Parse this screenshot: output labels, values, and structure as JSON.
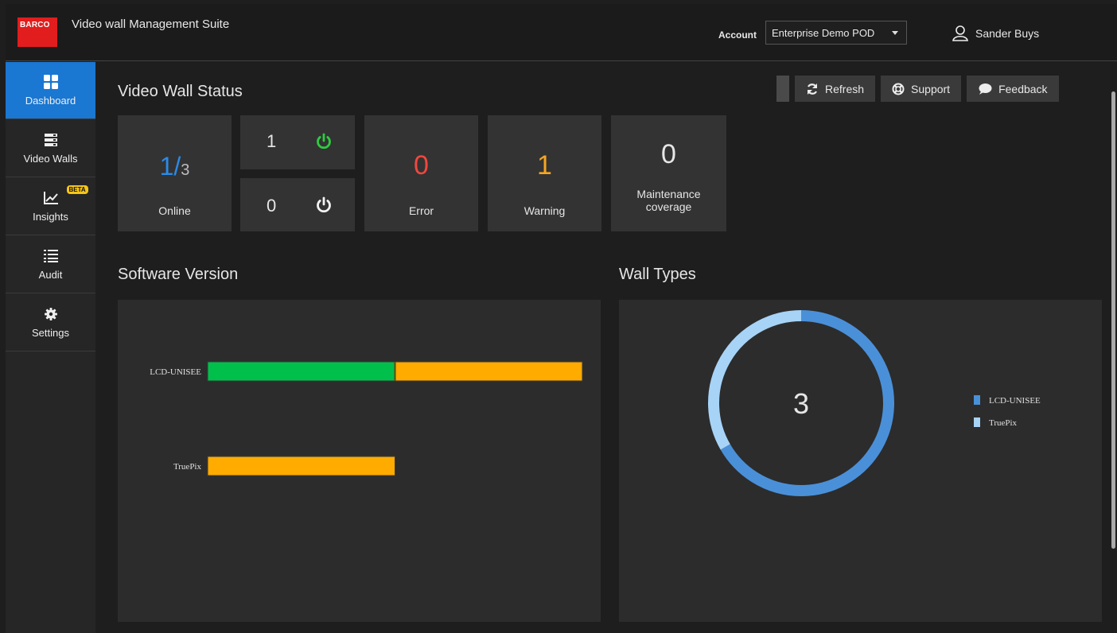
{
  "header": {
    "logo_text": "BARCO",
    "app_title": "Video wall Management Suite",
    "account_label": "Account",
    "account_value": "Enterprise Demo POD",
    "user_name": "Sander Buys"
  },
  "sidebar": {
    "items": [
      {
        "label": "Dashboard",
        "icon": "grid-icon",
        "active": true
      },
      {
        "label": "Video Walls",
        "icon": "server-icon"
      },
      {
        "label": "Insights",
        "icon": "chart-line-icon",
        "badge": "BETA"
      },
      {
        "label": "Audit",
        "icon": "list-icon"
      },
      {
        "label": "Settings",
        "icon": "gear-icon"
      }
    ]
  },
  "toolbar": {
    "refresh_label": "Refresh",
    "support_label": "Support",
    "feedback_label": "Feedback"
  },
  "status": {
    "title": "Video Wall Status",
    "online_count": "1",
    "online_sep": "/",
    "online_total": "3",
    "online_label": "Online",
    "powered_on": "1",
    "powered_off": "0",
    "error_value": "0",
    "error_label": "Error",
    "warning_value": "1",
    "warning_label": "Warning",
    "maintenance_value": "0",
    "maintenance_label": "Maintenance coverage",
    "colors": {
      "online": "#2a8be8",
      "power_on": "#2ecc40",
      "error": "#f0483e",
      "warning": "#f5a623"
    }
  },
  "software": {
    "title": "Software Version",
    "chart_data": {
      "type": "bar",
      "orientation": "horizontal",
      "stacked": true,
      "categories": [
        "LCD-UNISEE",
        "TruePix"
      ],
      "series": [
        {
          "color": "#00c04b",
          "values": [
            1,
            0
          ]
        },
        {
          "color": "#ffab00",
          "values": [
            1,
            1
          ]
        }
      ]
    }
  },
  "walltypes": {
    "title": "Wall Types",
    "total": "3",
    "chart_data": {
      "type": "pie",
      "donut": true,
      "labels": [
        "LCD-UNISEE",
        "TruePix"
      ],
      "values": [
        2,
        1
      ],
      "colors": [
        "#4a90d9",
        "#a7d3f7"
      ],
      "legend_position": "right"
    }
  }
}
